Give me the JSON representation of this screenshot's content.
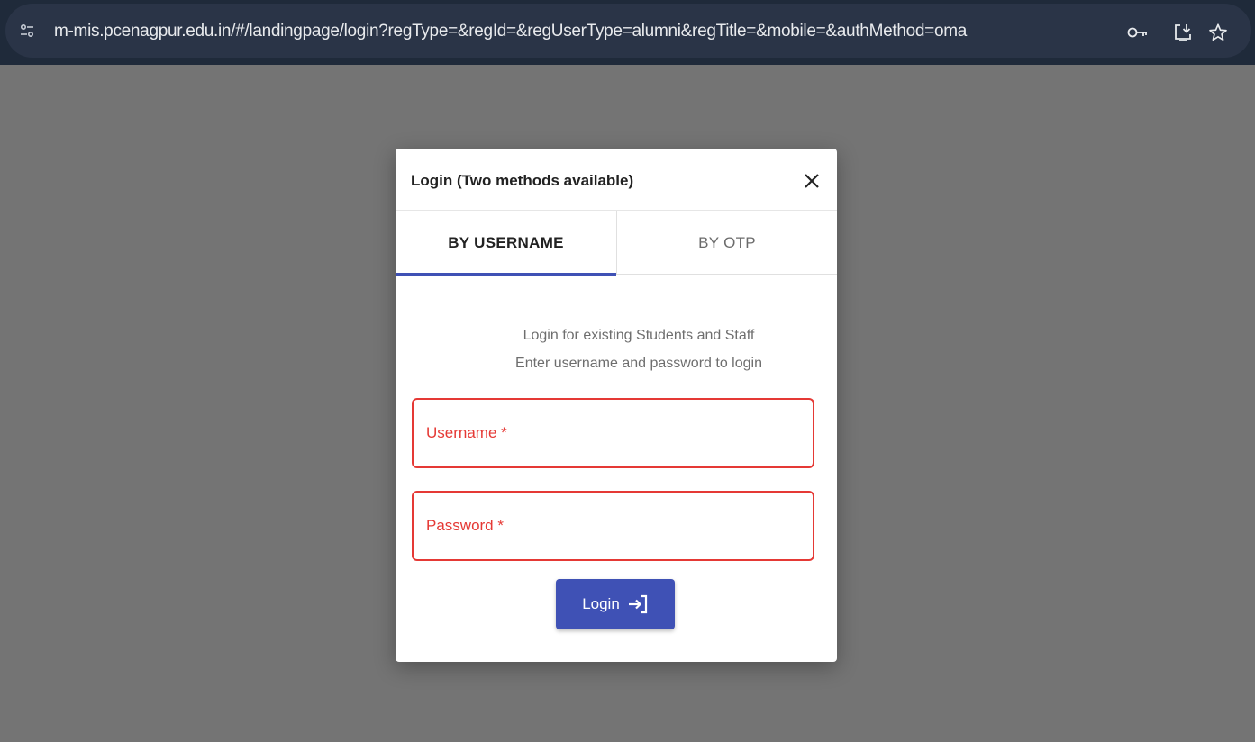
{
  "browser": {
    "url": "m-mis.pcenagpur.edu.in/#/landingpage/login?regType=&regId=&regUserType=alumni&regTitle=&mobile=&authMethod=oma",
    "icons": [
      "site-info-icon",
      "key-icon",
      "install-app-icon",
      "star-icon"
    ]
  },
  "dialog": {
    "title": "Login (Two methods available)",
    "tabs": [
      {
        "label": "BY USERNAME",
        "active": true
      },
      {
        "label": "BY OTP",
        "active": false
      }
    ],
    "intro": {
      "line1": "Login for existing Students and Staff",
      "line2": "Enter username and password to login"
    },
    "fields": {
      "username": {
        "placeholder": "Username *",
        "value": ""
      },
      "password": {
        "placeholder": "Password *",
        "value": ""
      }
    },
    "login_button": {
      "label": "Login",
      "icon": "login-icon"
    }
  },
  "colors": {
    "accent": "#3f51b5",
    "error": "#e53935",
    "overlay": "#747474",
    "browser_bar": "#1f2a3a"
  }
}
